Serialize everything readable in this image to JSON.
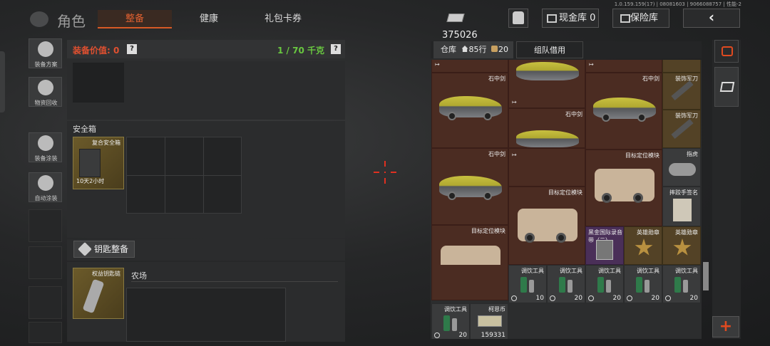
{
  "version_text": "1.0.159.159(17) | 08081603 | 9066088757 | 性能-2",
  "header": {
    "title": "角色",
    "tabs": [
      {
        "label": "整备",
        "active": true
      },
      {
        "label": "健康",
        "active": false
      },
      {
        "label": "礼包卡券",
        "active": false
      }
    ],
    "currency_amount": "375026",
    "cash_vault_label": "现金库 0",
    "insurance_label": "保险库"
  },
  "left_bar": [
    {
      "label": "装备方案",
      "icon": "loadout-icon"
    },
    {
      "label": "物资回收",
      "icon": "recycle-icon"
    },
    {
      "label": "装备涂装",
      "icon": "paint-icon"
    },
    {
      "label": "自动涂装",
      "icon": "auto-paint-icon"
    }
  ],
  "equipment": {
    "value_label": "装备价值: 0",
    "help": "?",
    "weight": "1 / 70 千克",
    "safebox_title": "安全箱",
    "safebox_item": {
      "name": "复合安全箱",
      "timer": "10天2小时"
    },
    "key_button": "钥匙整备",
    "key_item": {
      "name": "权益钥匙链"
    },
    "key_area_label": "农场"
  },
  "warehouse": {
    "tab_label": "仓库",
    "rows_label_1": "85行",
    "rows_label_2": "20行",
    "team_tab": "组队借用",
    "items": {
      "sword": "石中剑",
      "sword_extra": "装饰军刀",
      "module": "目标定位模块",
      "knuckles": "指虎",
      "sheet": "摔跤手签名",
      "gold_record": "黑金国际录音带（二）",
      "medal": "英雄勋章",
      "drink": "调饮工具",
      "coin": "柯恩币",
      "drink_counts": [
        "10",
        "20",
        "20",
        "20",
        "20",
        "20"
      ],
      "coin_count": "159331"
    }
  },
  "colors": {
    "accent": "#d85a26",
    "green": "#69c840",
    "brown_cell": "#4b2c22"
  }
}
